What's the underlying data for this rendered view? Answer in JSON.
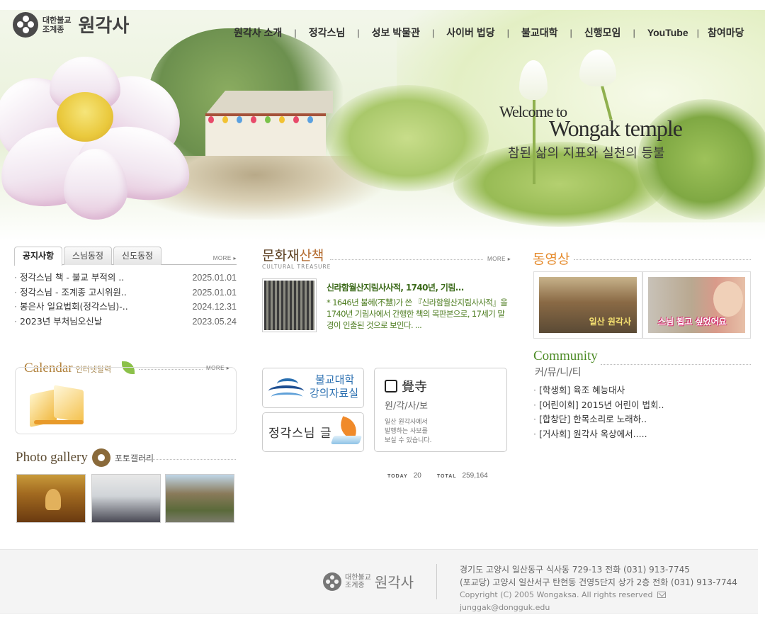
{
  "header": {
    "logo_sub_1": "대한불교",
    "logo_sub_2": "조계종",
    "logo_name": "원각사",
    "nav": [
      "원각사 소개",
      "정각스님",
      "성보 박물관",
      "사이버 법당",
      "불교대학",
      "신행모임",
      "YouTube",
      "참여마당"
    ],
    "nav_separator": "|"
  },
  "hero": {
    "line1": "Welcome to",
    "line2": "Wongak temple",
    "line3": "참된 삶의 지표와 실천의 등불"
  },
  "notice": {
    "tabs": [
      "공지사항",
      "스님동정",
      "신도동정"
    ],
    "more": "MORE ▸",
    "items": [
      {
        "title": "정각스님 책 - 불교 부적의 ..",
        "date": "2025.01.01"
      },
      {
        "title": "정각스님 - 조계종 고시위원..",
        "date": "2025.01.01"
      },
      {
        "title": "봉은사 일요법회(정각스님)-..",
        "date": "2024.12.31"
      },
      {
        "title": "2023년 부처님오신날",
        "date": "2023.05.24"
      }
    ]
  },
  "calendar": {
    "title": "Calendar",
    "title_kr": "인터넷달력",
    "more": "MORE ▸"
  },
  "gallery": {
    "title": "Photo gallery",
    "title_kr": "포토갤러리"
  },
  "heritage": {
    "title_a": "문화재",
    "title_b": "산책",
    "subtitle": "CULTURAL TREASURE",
    "more": "MORE ▸",
    "headline": "신라함월산지림사사적, 1740년, 기림...",
    "body": "* 1646년 불혜(不慧)가 쓴 『신라함월산지림사사적』을 1740년 기림사에서 간행한 책의 목판본으로, 17세기 말경이 인출된 것으로 보인다. ..."
  },
  "banners": {
    "college_line1": "불교대학",
    "college_line2": "강의자료실",
    "writing": "정각스님 글",
    "bulletin_title": "覺寺",
    "bulletin_sub": "원/각/사/보",
    "bulletin_desc_1": "일산 원각사에서",
    "bulletin_desc_2": "발행하는 사보를",
    "bulletin_desc_3": "보실 수 있습니다."
  },
  "counter": {
    "today_label": "TODAY",
    "today": "20",
    "total_label": "TOTAL",
    "total": "259,164"
  },
  "video": {
    "title": "동영상",
    "cap1": "일산 원각사",
    "cap2": "스님 뵙고 싶었어요"
  },
  "community": {
    "title": "Community",
    "title_kr": "커/뮤/니/티",
    "items": [
      "[학생회] 육조 혜능대사",
      "[어린이회] 2015년 어린이 법회..",
      "[합창단] 한목소리로 노래하..",
      "[거사회] 원각사 옥상에서....."
    ]
  },
  "footer": {
    "logo_sub_1": "대한불교",
    "logo_sub_2": "조계종",
    "logo_name": "원각사",
    "line1": "경기도 고양시 일산동구 식사동 729-13    전화 (031) 913-7745",
    "line2": "(포교당) 고양시 일산서구 탄현동 건영5단지 상가 2층    전화 (031) 913-7744",
    "copyright": "Copyright (C) 2005 Wongaksa. All rights reserved",
    "email": "junggak@dongguk.edu"
  }
}
